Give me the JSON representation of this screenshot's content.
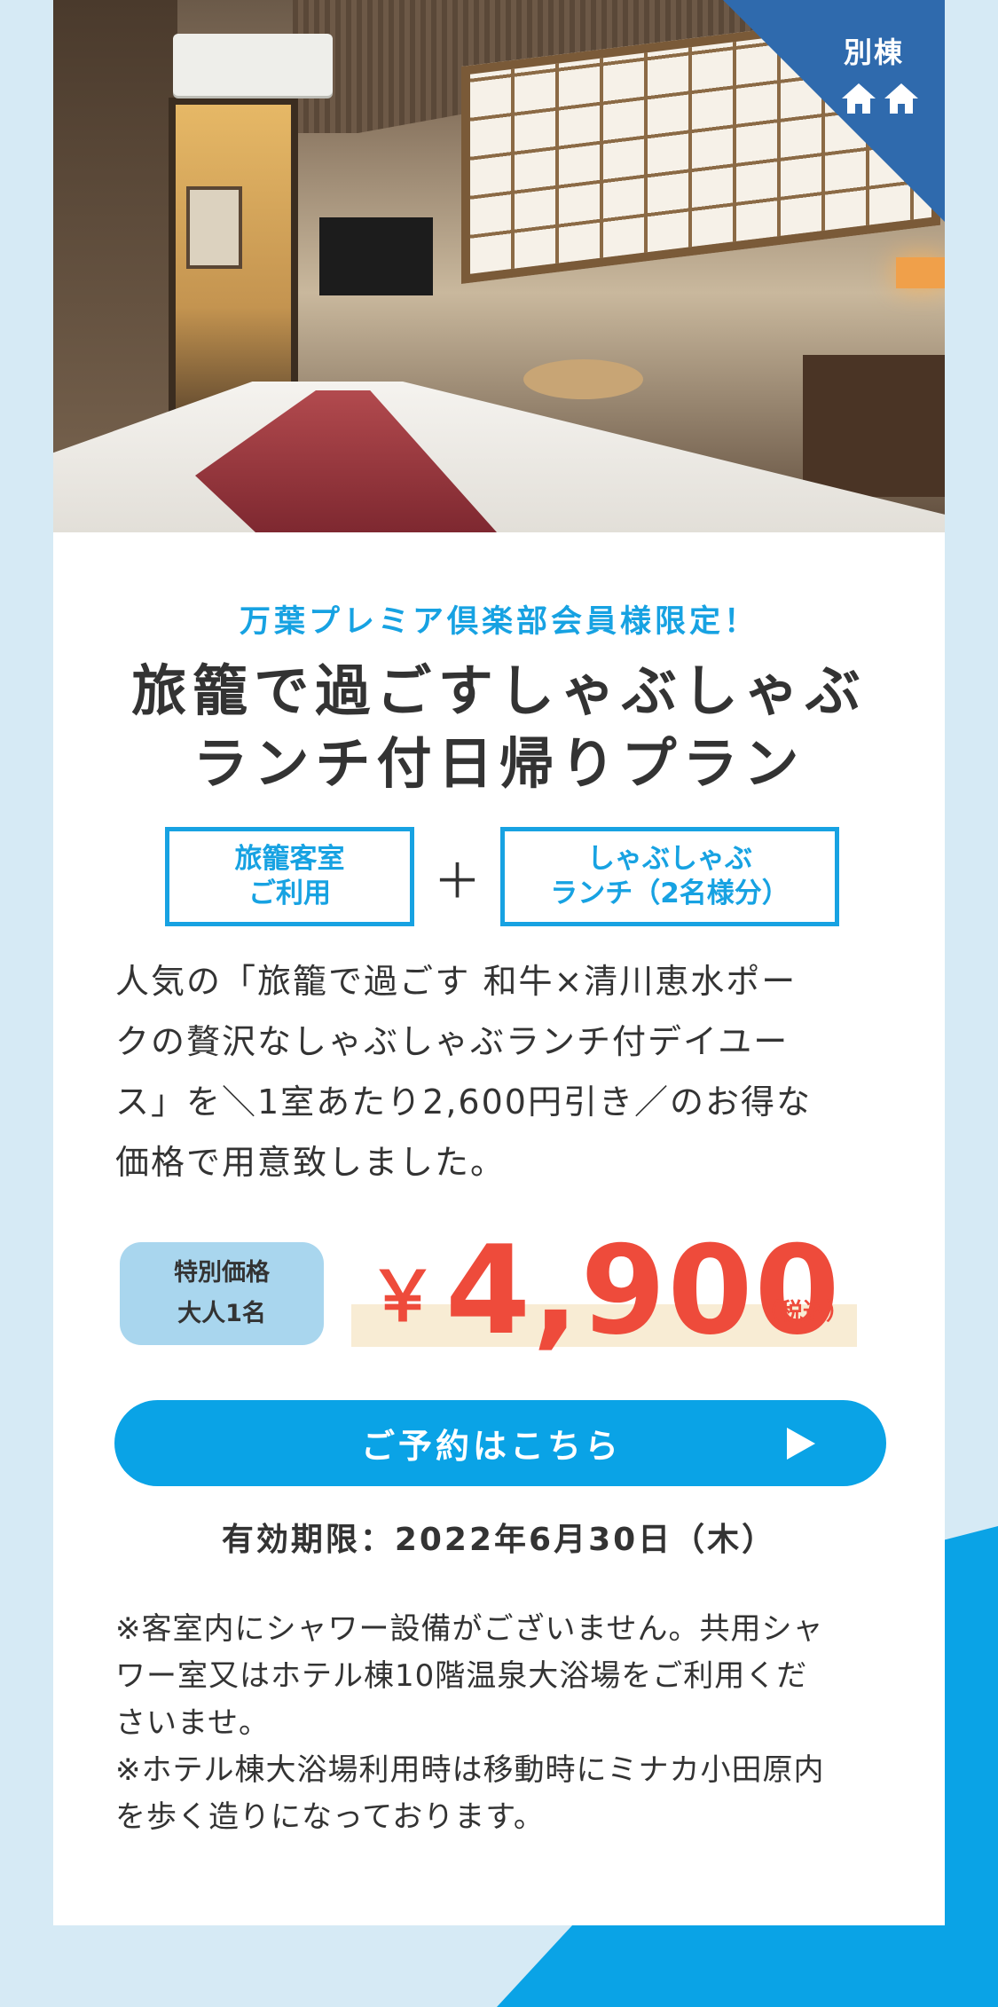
{
  "annex": {
    "label": "別棟",
    "icon_count": 2
  },
  "pre_title": "万葉プレミア倶楽部会員様限定！",
  "title": {
    "line1": "旅籠で過ごすしゃぶしゃぶ",
    "line2": "ランチ付日帰りプラン"
  },
  "combo": {
    "box1": {
      "line1": "旅籠客室",
      "line2": "ご利用"
    },
    "plus": "＋",
    "box2": {
      "line1": "しゃぶしゃぶ",
      "line2": "ランチ（2名様分）"
    }
  },
  "description": {
    "line1": "人気の「旅籠で過ごす 和牛×清川恵水ポー",
    "line2": "クの贅沢なしゃぶしゃぶランチ付デイユー",
    "line3": "ス」を＼1室あたり2,600円引き／のお得な",
    "line4": "価格で用意致しました。"
  },
  "price": {
    "tag_line1": "特別価格",
    "tag_line2": "大人1名",
    "currency": "￥",
    "amount": "4,900",
    "tax_note": "（税込）"
  },
  "reserve_button": {
    "label": "ご予約はこちら"
  },
  "validity": "有効期限：2022年6月30日（木）",
  "notes": {
    "line1": "※客室内にシャワー設備がございません。共用シャ",
    "line2": "ワー室又はホテル棟10階温泉大浴場をご利用くだ",
    "line3": "さいませ。",
    "line4": "※ホテル棟大浴場利用時は移動時にミナカ小田原内",
    "line5": "を歩く造りになっております。"
  },
  "colors": {
    "accent_blue": "#17a2e2",
    "button_blue": "#0aa3e6",
    "badge_blue": "#2f6aad",
    "price_red": "#ee4b3b",
    "background": "#d6eaf5"
  }
}
